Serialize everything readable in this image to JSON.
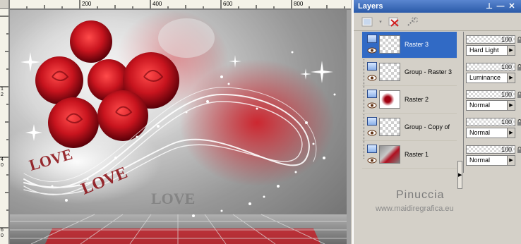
{
  "ruler": {
    "top_labels": [
      "200",
      "400",
      "600",
      "800"
    ],
    "left_labels": [
      "0",
      "4",
      "6",
      "8",
      "1",
      "2",
      "1",
      "4",
      "1",
      "6"
    ]
  },
  "artwork": {
    "text_marks": [
      "LOVE",
      "LOVE",
      "LOVE"
    ],
    "accent": "#c8141e"
  },
  "panel": {
    "title": "Layers"
  },
  "layers": [
    {
      "name": "Raster 3",
      "opacity": "100",
      "blend": "Hard Light",
      "selected": true,
      "type": "raster"
    },
    {
      "name": "Group - Raster 3",
      "opacity": "100",
      "blend": "Luminance",
      "selected": false,
      "type": "group"
    },
    {
      "name": "Raster 2",
      "opacity": "100",
      "blend": "Normal",
      "selected": false,
      "type": "raster"
    },
    {
      "name": "Group - Copy of",
      "opacity": "100",
      "blend": "Normal",
      "selected": false,
      "type": "group"
    },
    {
      "name": "Raster 1",
      "opacity": "100",
      "blend": "Normal",
      "selected": false,
      "type": "raster"
    }
  ],
  "watermark": {
    "name": "Pinuccia",
    "url": "www.maidiregrafica.eu"
  },
  "colors": {
    "titlebar": "#2a5aa8",
    "selection": "#316ac5",
    "panel_bg": "#d4d0c8"
  }
}
